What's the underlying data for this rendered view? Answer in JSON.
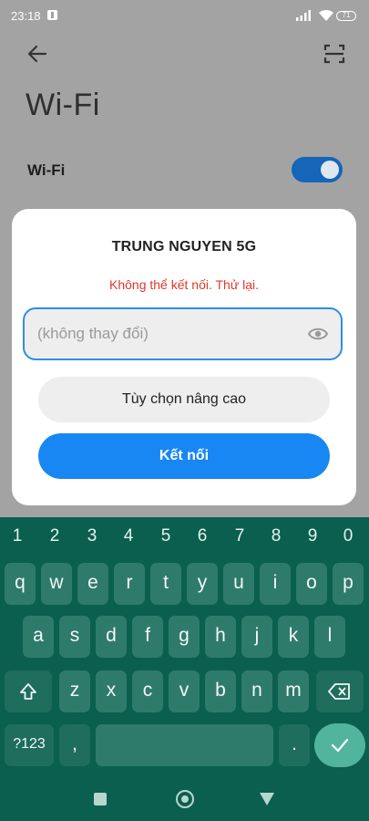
{
  "status_bar": {
    "time": "23:18",
    "battery": "71"
  },
  "header": {
    "back_icon": "arrow-left-icon",
    "scan_icon": "qr-scan-icon",
    "title": "Wi-Fi"
  },
  "wifi_setting": {
    "label": "Wi-Fi",
    "toggle_on": true,
    "accent": "#1565b8"
  },
  "dialog": {
    "network_name": "TRUNG NGUYEN 5G",
    "error_text": "Không thể kết nối. Thử lại.",
    "error_color": "#e0382a",
    "password_placeholder": "(không thay đổi)",
    "password_value": "",
    "show_password_icon": "eye-icon",
    "advanced_label": "Tùy chọn nâng cao",
    "connect_label": "Kết nối",
    "connect_color": "#1887f3"
  },
  "keyboard": {
    "numbers": [
      "1",
      "2",
      "3",
      "4",
      "5",
      "6",
      "7",
      "8",
      "9",
      "0"
    ],
    "row1": [
      "q",
      "w",
      "e",
      "r",
      "t",
      "y",
      "u",
      "i",
      "o",
      "p"
    ],
    "row2": [
      "a",
      "s",
      "d",
      "f",
      "g",
      "h",
      "j",
      "k",
      "l"
    ],
    "row3": [
      "z",
      "x",
      "c",
      "v",
      "b",
      "n",
      "m"
    ],
    "shift_icon": "shift-arrow-icon",
    "backspace_icon": "backspace-icon",
    "symbols_label": "?123",
    "comma_label": ",",
    "period_label": ".",
    "enter_icon": "checkmark-icon",
    "background": "#0b5f4f"
  },
  "nav_bar": {
    "recents_icon": "square-icon",
    "home_icon": "circle-icon",
    "back_icon": "triangle-icon"
  }
}
